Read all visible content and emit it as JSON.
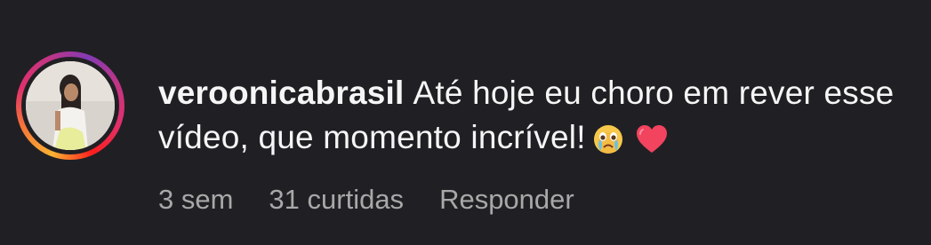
{
  "comment": {
    "username": "veroonicabrasil",
    "text": "Até hoje eu choro em rever esse vídeo, que momento incrível!",
    "emojis": [
      "crying-face-emoji",
      "red-heart-emoji"
    ],
    "time": "3 sem",
    "likes": "31 curtidas",
    "reply_label": "Responder"
  },
  "colors": {
    "background": "#202024",
    "text": "#f5f5f5",
    "meta_text": "#a8a8a8"
  }
}
